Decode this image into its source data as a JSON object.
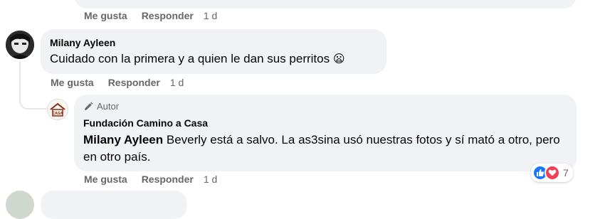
{
  "actions": {
    "like": "Me gusta",
    "reply": "Responder",
    "time": "1 d"
  },
  "comment1": {
    "author": "Milany Ayleen",
    "text": "Cuidado con la primera y a quien le dan sus perritos",
    "emoji": "😦"
  },
  "reply1": {
    "badge": "Autor",
    "author": "Fundación Camino a Casa",
    "mention": "Milany Ayleen",
    "text": "Beverly está a salvo. La as3sina usó nuestras fotos y sí mató a otro, pero en otro país.",
    "avatar_label": "CAMINO A CASA",
    "reaction_count": "7"
  },
  "colors": {
    "like_blue": "#1877f2",
    "love_red": "#f33e58",
    "bubble_bg": "#f0f2f5",
    "secondary_text": "#65676b"
  }
}
